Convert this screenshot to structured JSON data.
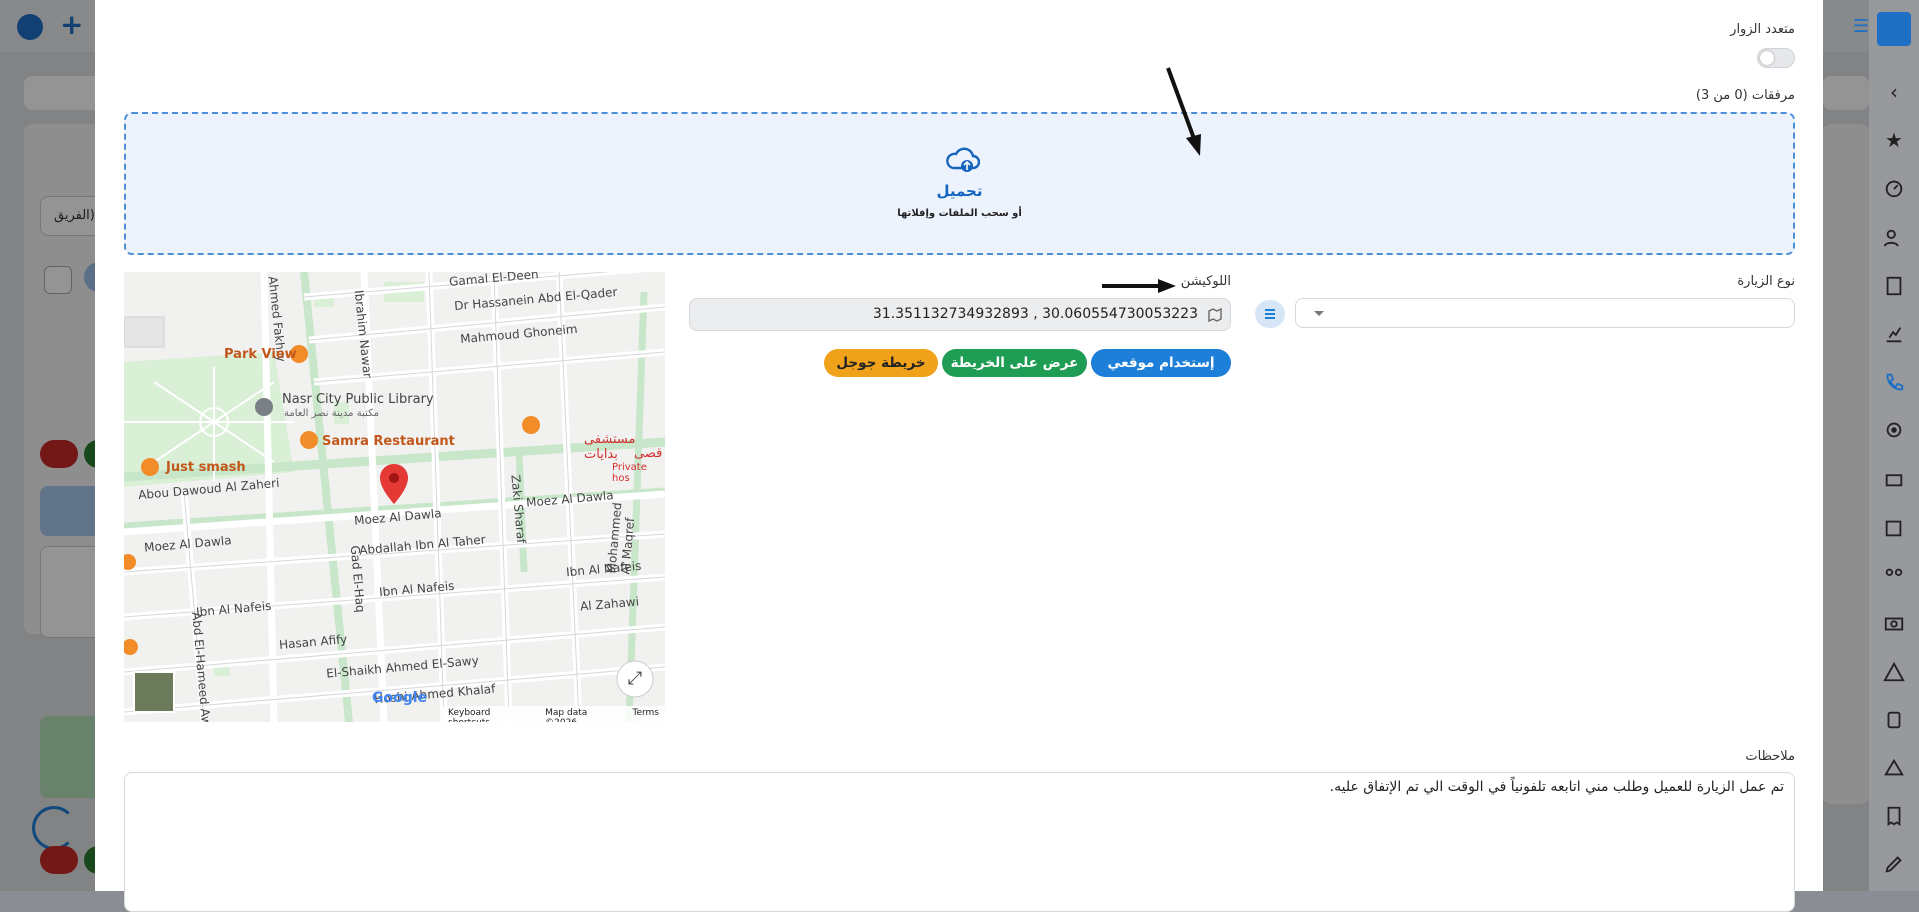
{
  "modal": {
    "multi_visitors_label": "متعدد الزوار",
    "attachments_label": "مرفقات (0 من 3)",
    "upload": {
      "title": "تحميل",
      "subtitle": "أو سحب الملفات وإفلاتها"
    },
    "visit_type_label": "نوع الزيارة",
    "location_label": "اللوكيشن",
    "coordinates_value": "31.351132734932893 , 30.060554730053223",
    "buttons": {
      "use_my_location": "إستخدام موقعي",
      "show_on_map": "عرض على الخريطة",
      "google_map": "خريطة جوجل"
    },
    "notes_label": "ملاحظات",
    "notes_text": "تم عمل الزيارة للعميل وطلب مني اتابعه تلفونياً في الوقت الي تم الإتفاق عليه."
  },
  "map": {
    "streets": {
      "gamal": "Gamal El-Deen",
      "hassanein": "Dr Hassanein Abd El-Qader",
      "ghoneim": "Mahmoud Ghoneim",
      "fakhry": "Ahmed Fakhry",
      "nawar": "Ibrahim Nawar",
      "abou_dawoud": "Abou Dawoud Al Zaheri",
      "moez1": "Moez Al Dawla",
      "moez2": "Moez Al Dawla",
      "moez3": "Moez Al Dawla",
      "zaki": "Zaki Sharaf",
      "abdallah": "Abdallah Ibn Al Taher",
      "nafeis1": "Ibn Al Nafeis",
      "nafeis2": "Ibn Al Nafeis",
      "nafeis3": "Ibn Al Nafeis",
      "zahawi": "Al Zahawi",
      "gad": "Gad El-Haq",
      "hasan": "Hasan Afify",
      "elsawy": "El-Shaikh Ahmed El-Sawy",
      "hoshi": "Hoshi Ahmed Khalaf",
      "maqref": "Mohammed Al Maqref",
      "hameed": "Abd El-Hameed Aw"
    },
    "places": {
      "park_view": "Park View",
      "library": "Nasr City Public Library",
      "library_ar": "مكتبة مدينة نصر العامة",
      "samra": "Samra Restaurant",
      "just_smash": "Just smash",
      "hospital_ar": "مستشفى بدايات",
      "hospital_ar2": "قصى",
      "hospital": "Private hos"
    },
    "footer": {
      "google": "Google",
      "shortcuts": "Keyboard shortcuts",
      "map_data": "Map data ©2026",
      "terms": "Terms"
    }
  },
  "background": {
    "team_label": "الفريق)"
  },
  "colors": {
    "primary_blue": "#1e7fd8",
    "green": "#1f9d55",
    "orange": "#f0a21a",
    "upload_blue": "#1565c0"
  },
  "icons": [
    "cloud-upload-icon",
    "map-icon",
    "arrow-annotation",
    "star-icon",
    "sidebar-icons"
  ]
}
